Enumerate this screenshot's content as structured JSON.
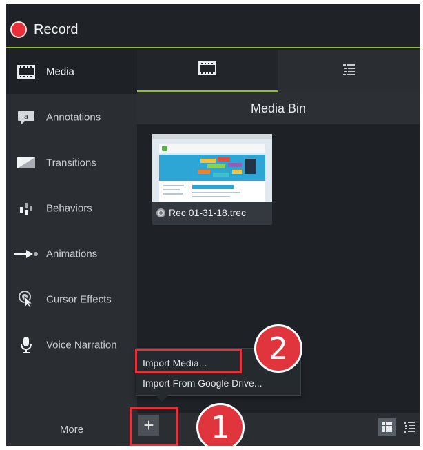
{
  "header": {
    "record_label": "Record",
    "colors": {
      "record_dot": "#e8303b",
      "accent": "#8fbf2e"
    }
  },
  "sidebar": {
    "items": [
      {
        "label": "Media",
        "icon": "film-strip-icon",
        "active": true
      },
      {
        "label": "Annotations",
        "icon": "callout-icon",
        "active": false
      },
      {
        "label": "Transitions",
        "icon": "transition-icon",
        "active": false
      },
      {
        "label": "Behaviors",
        "icon": "behaviors-icon",
        "active": false
      },
      {
        "label": "Animations",
        "icon": "animation-arrow-icon",
        "active": false
      },
      {
        "label": "Cursor Effects",
        "icon": "cursor-effects-icon",
        "active": false
      },
      {
        "label": "Voice Narration",
        "icon": "microphone-icon",
        "active": false
      }
    ],
    "more_label": "More"
  },
  "tabs": [
    {
      "icon": "film-strip-icon",
      "active": true
    },
    {
      "icon": "list-icon",
      "active": false
    }
  ],
  "media_bin": {
    "title": "Media Bin",
    "items": [
      {
        "name": "Rec 01-31-18.trec",
        "icon": "recording-file-icon"
      }
    ]
  },
  "context_menu": {
    "items": [
      "Import Media...",
      "Import From Google Drive..."
    ]
  },
  "bottom_bar": {
    "add_label": "+",
    "view_modes": [
      "grid-view-icon",
      "list-view-icon"
    ]
  },
  "annotations": {
    "step1": "1",
    "step2": "2",
    "highlight_color": "#e2323a"
  }
}
